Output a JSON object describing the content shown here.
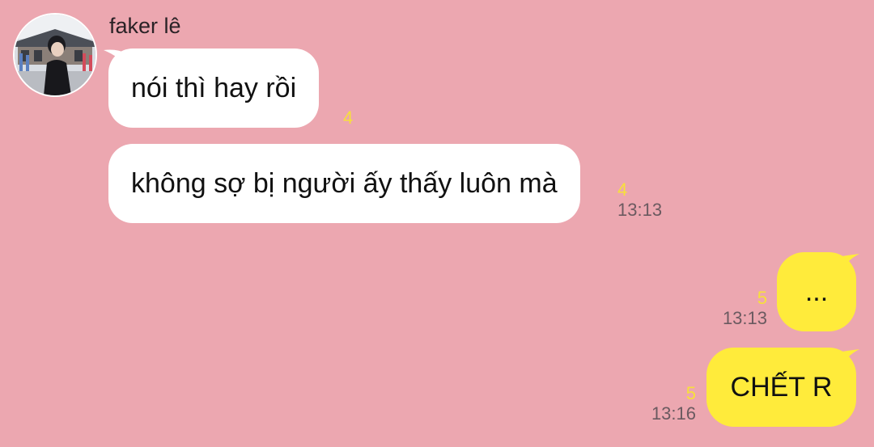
{
  "colors": {
    "background": "#eca7b0",
    "incoming_bubble": "#ffffff",
    "outgoing_bubble": "#ffeb3b",
    "read_count": "#f7e03a",
    "timestamp": "#6b5a60"
  },
  "chat": {
    "sender_name": "faker lê",
    "messages": [
      {
        "direction": "incoming",
        "text": "nói thì hay rồi",
        "unread_count": "4",
        "time": ""
      },
      {
        "direction": "incoming",
        "text": "không sợ bị người ấy thấy luôn mà",
        "unread_count": "4",
        "time": "13:13"
      },
      {
        "direction": "outgoing",
        "text": "...",
        "unread_count": "5",
        "time": "13:13"
      },
      {
        "direction": "outgoing",
        "text": "CHẾT R",
        "unread_count": "5",
        "time": "13:16"
      }
    ]
  }
}
